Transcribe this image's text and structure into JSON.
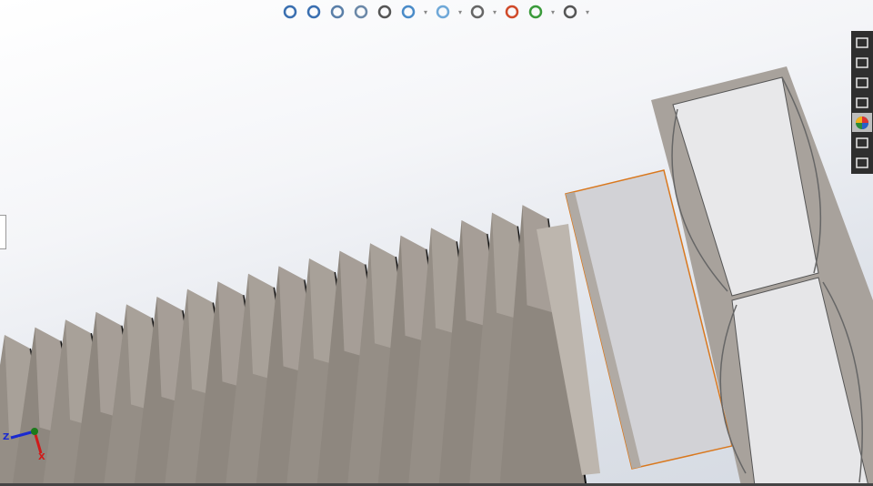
{
  "toolbar": {
    "items": [
      {
        "name": "zoom-to-fit-icon",
        "dropdown": false
      },
      {
        "name": "zoom-to-area-icon",
        "dropdown": false
      },
      {
        "name": "previous-view-icon",
        "dropdown": false
      },
      {
        "name": "section-view-icon",
        "dropdown": false
      },
      {
        "name": "dynamic-annotation-views-icon",
        "dropdown": false
      },
      {
        "name": "view-orientation-icon",
        "dropdown": true
      },
      {
        "name": "display-style-icon",
        "dropdown": true
      },
      {
        "name": "hide-show-items-icon",
        "dropdown": true
      },
      {
        "name": "edit-appearance-icon",
        "dropdown": false
      },
      {
        "name": "apply-scene-icon",
        "dropdown": true
      },
      {
        "name": "view-settings-icon",
        "dropdown": true
      }
    ]
  },
  "taskpane": {
    "items": [
      {
        "name": "solidworks-resources-icon",
        "active": false
      },
      {
        "name": "design-library-icon",
        "active": false
      },
      {
        "name": "file-explorer-icon",
        "active": false
      },
      {
        "name": "view-palette-icon",
        "active": false
      },
      {
        "name": "appearances-scenes-icon",
        "active": true
      },
      {
        "name": "custom-properties-icon",
        "active": false
      },
      {
        "name": "solidworks-forum-icon",
        "active": false
      }
    ]
  },
  "triad": {
    "z_label": "Z",
    "x_label": "X"
  },
  "colors": {
    "selection": "#d9781e",
    "thread": "#8e877f",
    "head": "#e6e6e8",
    "taskpane_bg": "#2f2f2f"
  }
}
